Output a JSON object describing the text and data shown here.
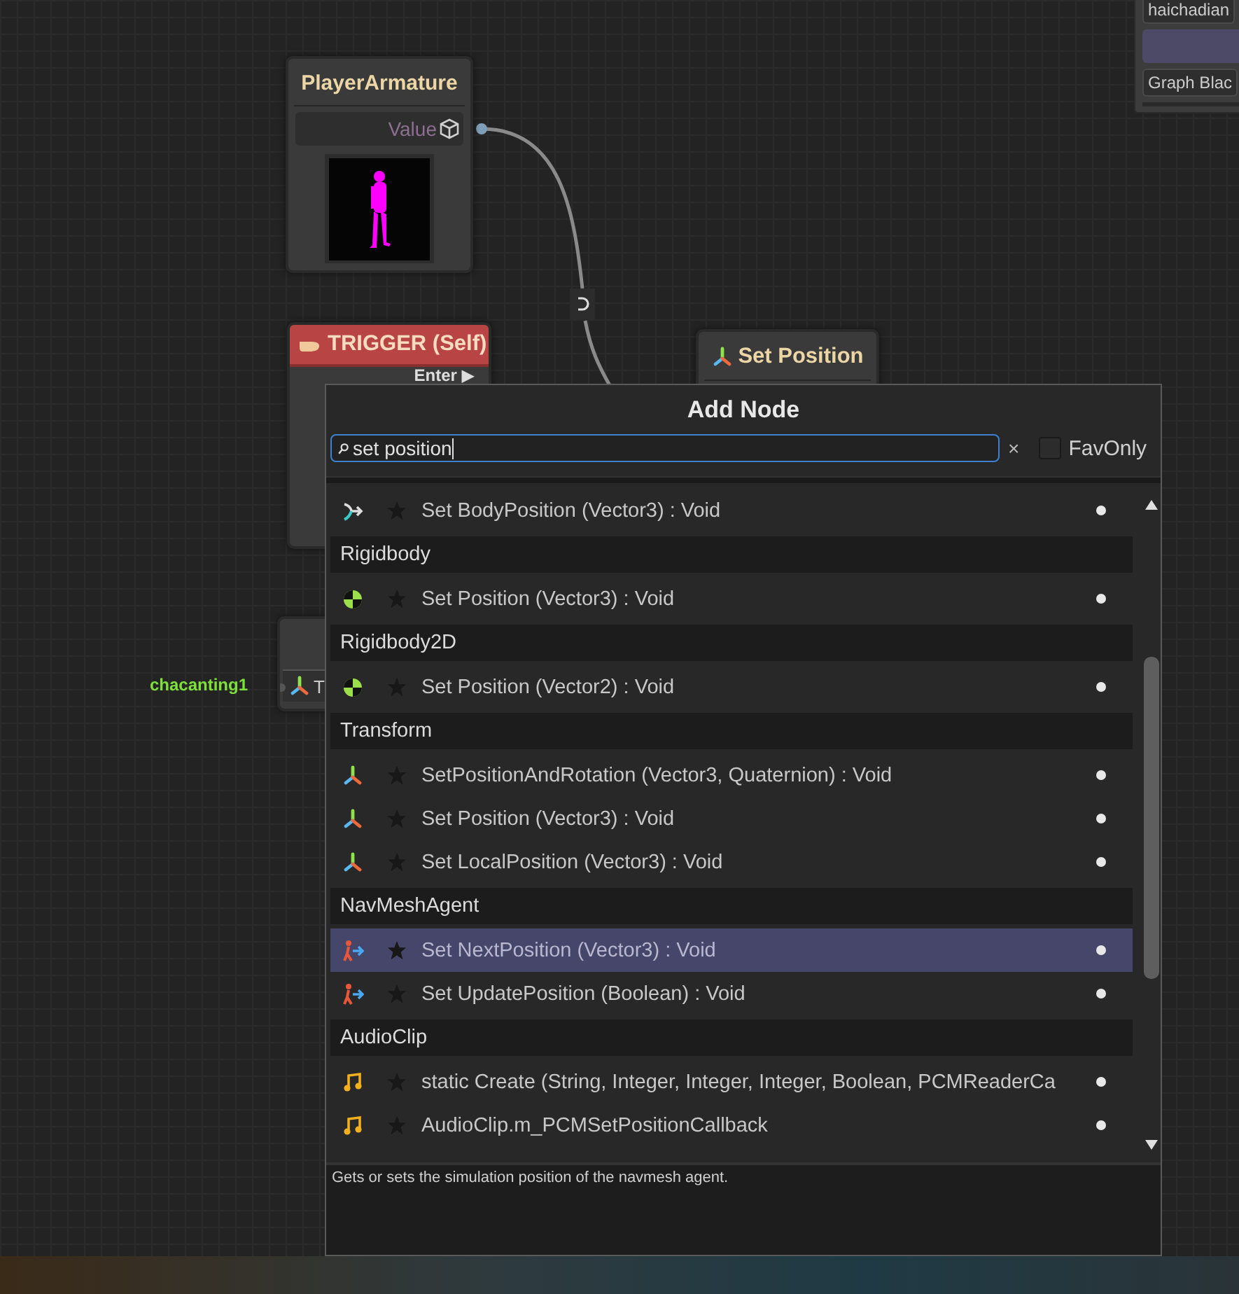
{
  "graph": {
    "nodes": [
      {
        "kind": "object",
        "title": "PlayerArmature",
        "port": "Value"
      },
      {
        "kind": "event",
        "title": "TRIGGER (Self)",
        "port": "Enter ▶"
      },
      {
        "kind": "action",
        "title": "Set Position"
      },
      {
        "kind": "compact",
        "title": "T",
        "input_label": "chacanting1"
      }
    ]
  },
  "side_panel": {
    "fields": [
      "haichadian",
      "Graph Blac"
    ]
  },
  "add_node": {
    "title": "Add Node",
    "search": {
      "value": "set position"
    },
    "clear": "×",
    "fav_only": {
      "label": "FavOnly",
      "checked": false
    },
    "entries": [
      {
        "kind": "body",
        "label": "Set BodyPosition (Vector3) : Void",
        "favorite": false,
        "selected": false
      },
      {
        "kind": "header",
        "label": "Rigidbody"
      },
      {
        "kind": "rigidbody",
        "label": "Set Position (Vector3) : Void",
        "favorite": false,
        "selected": false
      },
      {
        "kind": "header",
        "label": "Rigidbody2D"
      },
      {
        "kind": "rigidbody",
        "label": "Set Position (Vector2) : Void",
        "favorite": false,
        "selected": false
      },
      {
        "kind": "header",
        "label": "Transform"
      },
      {
        "kind": "transform",
        "label": "SetPositionAndRotation (Vector3, Quaternion) : Void",
        "favorite": false,
        "selected": false
      },
      {
        "kind": "transform",
        "label": "Set Position (Vector3) : Void",
        "favorite": false,
        "selected": false
      },
      {
        "kind": "transform",
        "label": "Set LocalPosition (Vector3) : Void",
        "favorite": false,
        "selected": false
      },
      {
        "kind": "header",
        "label": "NavMeshAgent"
      },
      {
        "kind": "agent",
        "label": "Set NextPosition (Vector3) : Void",
        "favorite": false,
        "selected": true
      },
      {
        "kind": "agent",
        "label": "Set UpdatePosition (Boolean) : Void",
        "favorite": false,
        "selected": false
      },
      {
        "kind": "header",
        "label": "AudioClip"
      },
      {
        "kind": "audio",
        "label": "static Create (String, Integer, Integer, Integer, Boolean, PCMReaderCa",
        "favorite": false,
        "selected": false
      },
      {
        "kind": "audio",
        "label": "AudioClip.m_PCMSetPositionCallback",
        "favorite": false,
        "selected": false
      }
    ],
    "description": "Gets or sets the simulation position of the navmesh agent."
  }
}
